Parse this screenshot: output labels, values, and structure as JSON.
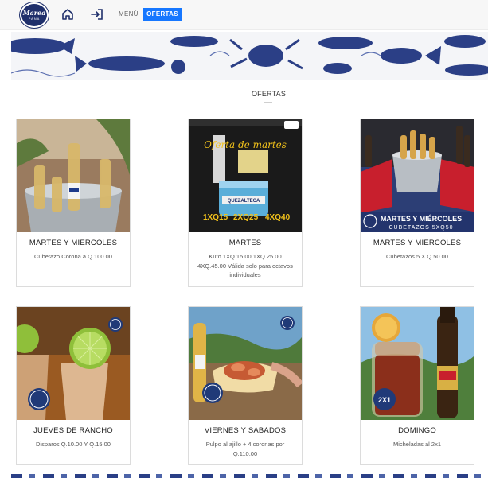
{
  "header": {
    "logo_line1": "Marea",
    "logo_line2": "PANA",
    "menu_label": "MENÚ",
    "ofertas_label": "OFERTAS",
    "home_icon": "home-icon",
    "login_icon": "login-icon"
  },
  "section": {
    "title": "OFERTAS"
  },
  "offers": [
    {
      "title": "MARTES Y MIERCOLES",
      "desc": "Cubetazo Corona a Q.100.00"
    },
    {
      "title": "MARTES",
      "desc": "Kuto 1XQ.15.00 1XQ.25.00 4XQ.45.00 Válida solo para octavos individuales",
      "promo": {
        "heading": "Oferta de martes",
        "prices": [
          "1XQ15",
          "2XQ25",
          "4XQ40"
        ],
        "mug_text": "QUEZALTECA"
      }
    },
    {
      "title": "MARTES Y MIÉRCOLES",
      "desc": "Cubetazos 5 X Q.50.00",
      "promo": {
        "line1": "MARTES Y MIÉRCOLES",
        "line2": "CUBETAZOS 5XQ50"
      }
    },
    {
      "title": "JUEVES DE RANCHO",
      "desc": "Disparos Q.10.00 Y Q.15.00"
    },
    {
      "title": "VIERNES Y SABADOS",
      "desc": "Pulpo al ajillo + 4 coronas por Q.110.00"
    },
    {
      "title": "DOMINGO",
      "desc": "Micheladas al 2x1",
      "promo": {
        "badge": "2X1"
      }
    }
  ],
  "colors": {
    "brand_navy": "#1f2f6b",
    "accent_blue": "#1677ff",
    "promo_yellow": "#f2c21b"
  }
}
